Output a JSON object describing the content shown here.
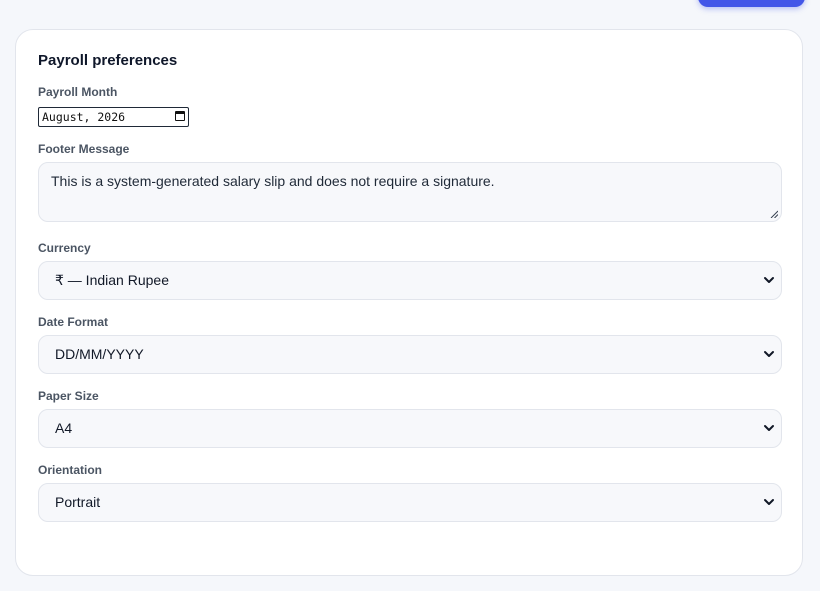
{
  "form": {
    "title": "Payroll preferences",
    "payroll_month": {
      "label": "Payroll Month",
      "value": "August, 2026"
    },
    "footer_message": {
      "label": "Footer Message",
      "value": "This is a system-generated salary slip and does not require a signature."
    },
    "currency": {
      "label": "Currency",
      "value": "₹ — Indian Rupee"
    },
    "date_format": {
      "label": "Date Format",
      "value": "DD/MM/YYYY"
    },
    "paper_size": {
      "label": "Paper Size",
      "value": "A4"
    },
    "orientation": {
      "label": "Orientation",
      "value": "Portrait"
    }
  },
  "colors": {
    "accent": "#4356e8",
    "card_bg": "#ffffff",
    "page_bg": "#f5f7fb",
    "field_bg": "#f7f8fb",
    "label": "#4b5563"
  },
  "icons": [
    "calendar-icon",
    "resize-handle-icon",
    "chevron-down-icon"
  ]
}
